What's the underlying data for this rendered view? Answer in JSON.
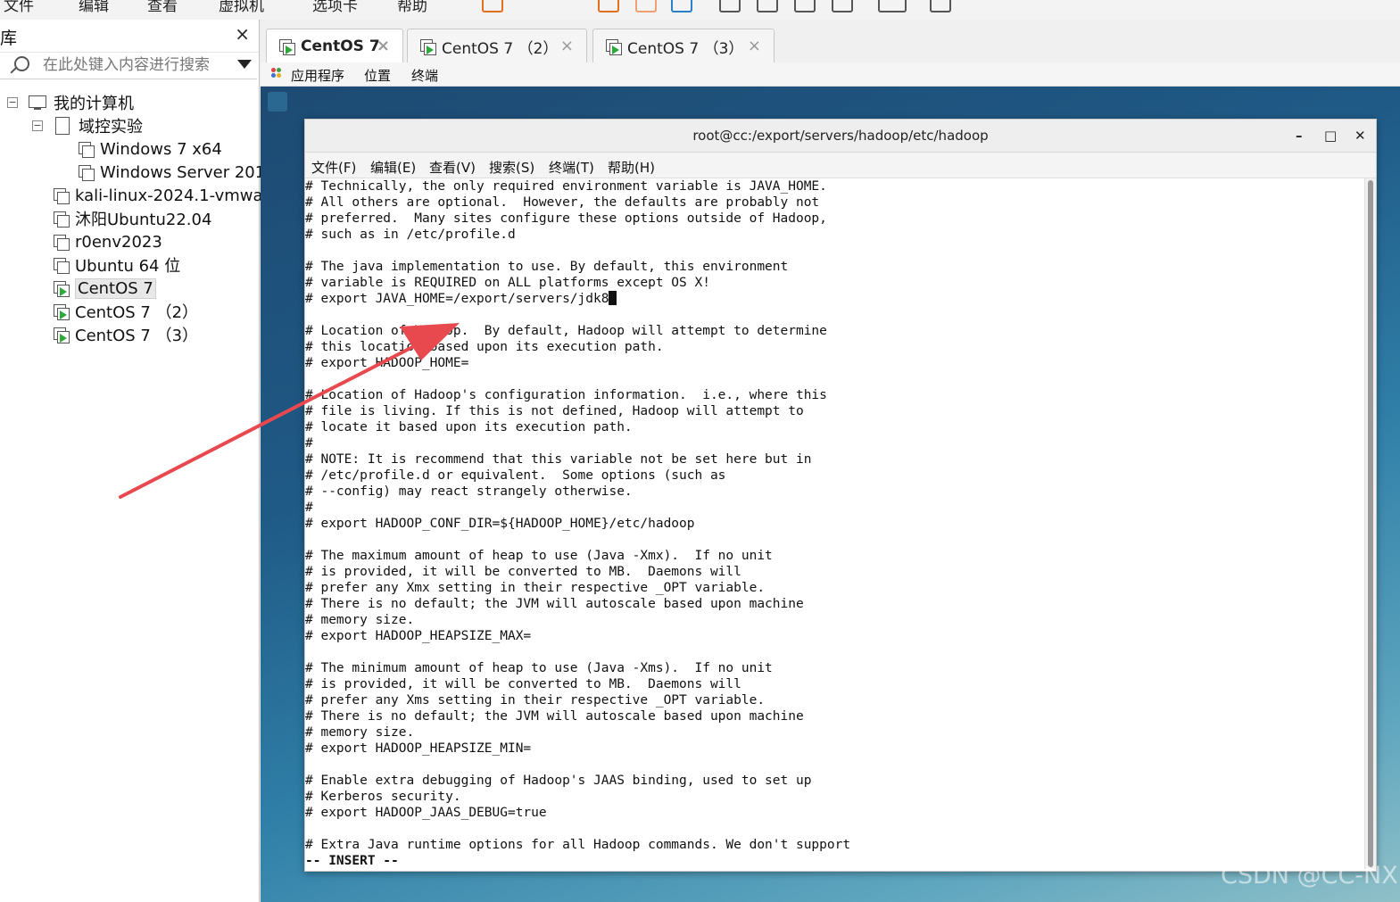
{
  "toolbar": {
    "menu_fragments": [
      "文件",
      "编辑",
      "查看",
      "虚拟机",
      "选项卡",
      "帮助"
    ]
  },
  "library": {
    "title": "库",
    "close_glyph": "×",
    "search_placeholder": "在此处键入内容进行搜索",
    "tree": {
      "root": "我的计算机",
      "folder": "域控实验",
      "folder_items": [
        "Windows 7 x64",
        "Windows Server 201"
      ],
      "items": [
        "kali-linux-2024.1-vmwa",
        "沐阳Ubuntu22.04",
        "r0env2023",
        "Ubuntu 64 位"
      ],
      "running": [
        "CentOS 7",
        "CentOS 7 （2）",
        "CentOS 7 （3）"
      ],
      "expand_glyph": "−"
    }
  },
  "tabs": [
    {
      "label": "CentOS 7",
      "active": true
    },
    {
      "label": "CentOS 7 （2）",
      "active": false
    },
    {
      "label": "CentOS 7 （3）",
      "active": false
    }
  ],
  "tab_close_glyph": "×",
  "guest": {
    "menu": [
      "应用程序",
      "位置",
      "终端"
    ]
  },
  "terminal": {
    "title": "root@cc:/export/servers/hadoop/etc/hadoop",
    "min_glyph": "–",
    "max_glyph": "□",
    "close_glyph": "✕",
    "menu": [
      "文件(F)",
      "编辑(E)",
      "查看(V)",
      "搜索(S)",
      "终端(T)",
      "帮助(H)"
    ],
    "lines_before_cursor": "# Technically, the only required environment variable is JAVA_HOME.\n# All others are optional.  However, the defaults are probably not\n# preferred.  Many sites configure these options outside of Hadoop,\n# such as in /etc/profile.d\n\n# The java implementation to use. By default, this environment\n# variable is REQUIRED on ALL platforms except OS X!\n# export JAVA_HOME=/export/servers/jdk8",
    "lines_after_cursor": "\n\n# Location of Hadoop.  By default, Hadoop will attempt to determine\n# this location based upon its execution path.\n# export HADOOP_HOME=\n\n# Location of Hadoop's configuration information.  i.e., where this\n# file is living. If this is not defined, Hadoop will attempt to\n# locate it based upon its execution path.\n#\n# NOTE: It is recommend that this variable not be set here but in\n# /etc/profile.d or equivalent.  Some options (such as\n# --config) may react strangely otherwise.\n#\n# export HADOOP_CONF_DIR=${HADOOP_HOME}/etc/hadoop\n\n# The maximum amount of heap to use (Java -Xmx).  If no unit\n# is provided, it will be converted to MB.  Daemons will\n# prefer any Xmx setting in their respective _OPT variable.\n# There is no default; the JVM will autoscale based upon machine\n# memory size.\n# export HADOOP_HEAPSIZE_MAX=\n\n# The minimum amount of heap to use (Java -Xms).  If no unit\n# is provided, it will be converted to MB.  Daemons will\n# prefer any Xms setting in their respective _OPT variable.\n# There is no default; the JVM will autoscale based upon machine\n# memory size.\n# export HADOOP_HEAPSIZE_MIN=\n\n# Enable extra debugging of Hadoop's JAAS binding, used to set up\n# Kerberos security.\n# export HADOOP_JAAS_DEBUG=true\n\n# Extra Java runtime options for all Hadoop commands. We don't support",
    "status": "-- INSERT --"
  },
  "watermark": "CSDN @CC-NX",
  "colors": {
    "arrow": "#e8494f",
    "running_play": "#2ea83a",
    "desktop": "#1f5a86"
  }
}
